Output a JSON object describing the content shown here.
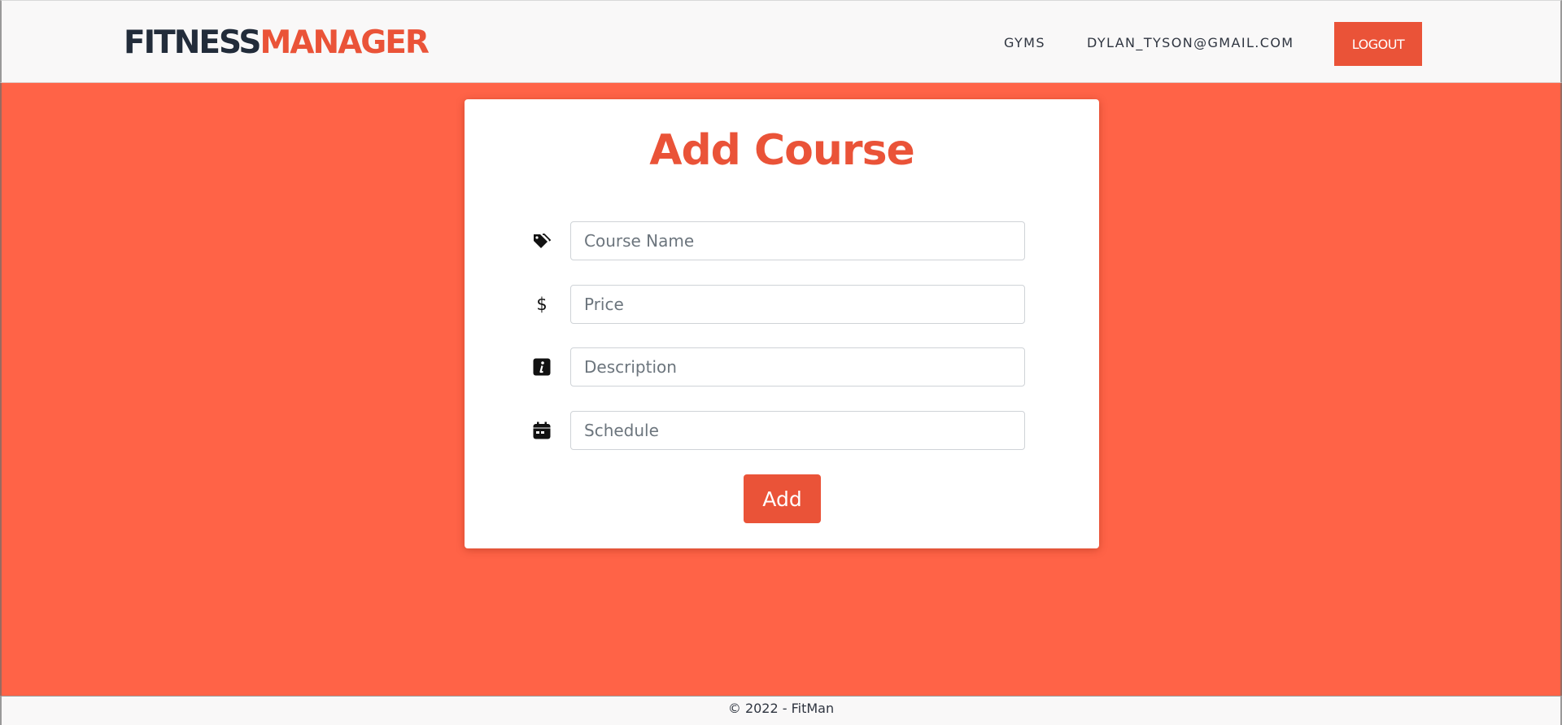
{
  "header": {
    "brand_part1": "FITNESS",
    "brand_part2": "MANAGER",
    "nav": {
      "gyms_label": "GYMS",
      "user_email": "DYLAN_TYSON@GMAIL.COM",
      "logout_label": "LOGOUT"
    }
  },
  "form": {
    "title": "Add Course",
    "fields": [
      {
        "icon": "tags-icon",
        "placeholder": "Course Name",
        "value": ""
      },
      {
        "icon": "dollar-icon",
        "icon_text": "$",
        "placeholder": "Price",
        "value": ""
      },
      {
        "icon": "info-icon",
        "placeholder": "Description",
        "value": ""
      },
      {
        "icon": "calendar-icon",
        "placeholder": "Schedule",
        "value": ""
      }
    ],
    "submit_label": "Add"
  },
  "footer": {
    "text": "© 2022 - FitMan"
  },
  "colors": {
    "background": "#ff6347",
    "accent": "#ea5338",
    "brand_dark": "#222c3a",
    "navbar_bg": "#f9f8f8",
    "card_bg": "#ffffff"
  }
}
